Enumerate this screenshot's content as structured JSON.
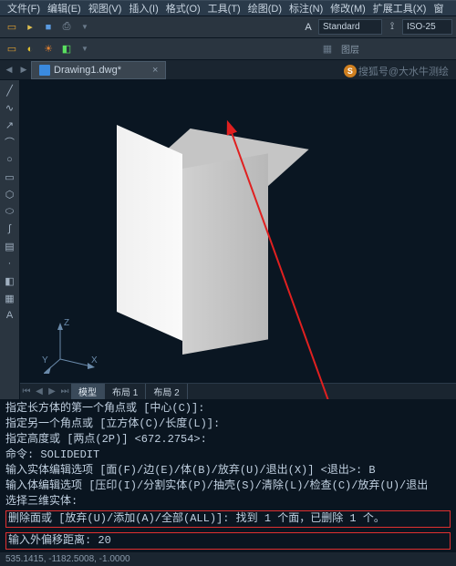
{
  "menu": {
    "items": [
      "文件(F)",
      "编辑(E)",
      "视图(V)",
      "插入(I)",
      "格式(O)",
      "工具(T)",
      "绘图(D)",
      "标注(N)",
      "修改(M)",
      "扩展工具(X)",
      "窗"
    ]
  },
  "toolbar": {
    "layer_label": "图层",
    "style1": "Standard",
    "style2": "ISO-25"
  },
  "file": {
    "name": "Drawing1.dwg*",
    "close": "×"
  },
  "axis": {
    "x": "X",
    "y": "Y",
    "z": "Z"
  },
  "tabs": {
    "model": "模型",
    "layout1": "布局 1",
    "layout2": "布局 2"
  },
  "cmd": {
    "l1": "指定长方体的第一个角点或 [中心(C)]:",
    "l2": "指定另一个角点或 [立方体(C)/长度(L)]:",
    "l3": "指定高度或 [两点(2P)] <672.2754>:",
    "l4": "命令: SOLIDEDIT",
    "l5": "输入实体编辑选项 [面(F)/边(E)/体(B)/放弃(U)/退出(X)] <退出>: B",
    "l6": "输入体编辑选项 [压印(I)/分割实体(P)/抽壳(S)/清除(L)/检查(C)/放弃(U)/退出",
    "l7": "选择三维实体:",
    "hl1": "删除面或 [放弃(U)/添加(A)/全部(ALL)]: 找到 1 个面，已删除 1 个。",
    "hl2": "输入外偏移距离: 20"
  },
  "status": {
    "coords": "535.1415, -1182.5008, -1.0000"
  },
  "watermark": {
    "text": "搜狐号@大水牛测绘",
    "icon": "S"
  }
}
